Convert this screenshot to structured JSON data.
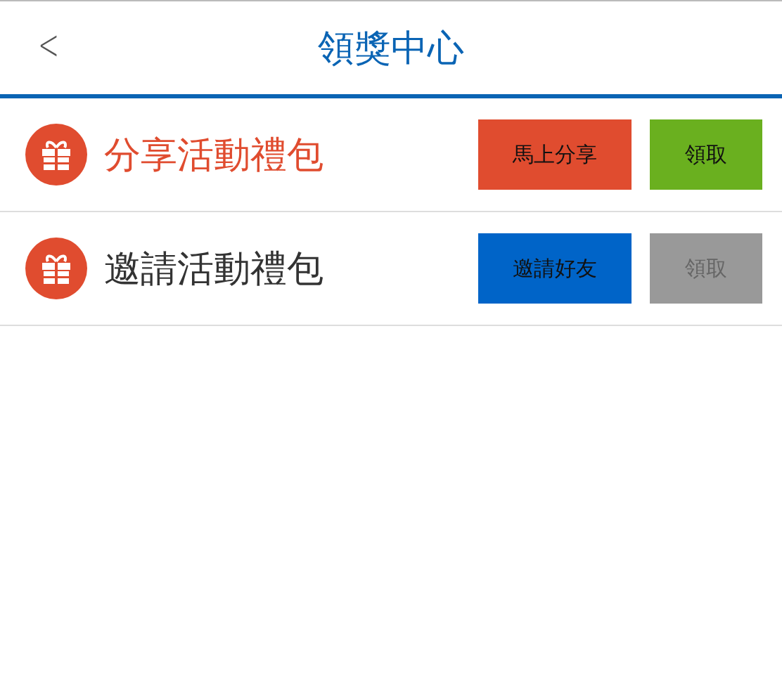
{
  "header": {
    "back": "<",
    "title": "領獎中心"
  },
  "packages": [
    {
      "name": "分享活動禮包",
      "highlighted": true,
      "action": {
        "label": "馬上分享",
        "color": "#e04c2f"
      },
      "claim": {
        "label": "領取",
        "disabled": false
      }
    },
    {
      "name": "邀請活動禮包",
      "highlighted": false,
      "action": {
        "label": "邀請好友",
        "color": "#0064c8"
      },
      "claim": {
        "label": "領取",
        "disabled": true
      }
    }
  ]
}
